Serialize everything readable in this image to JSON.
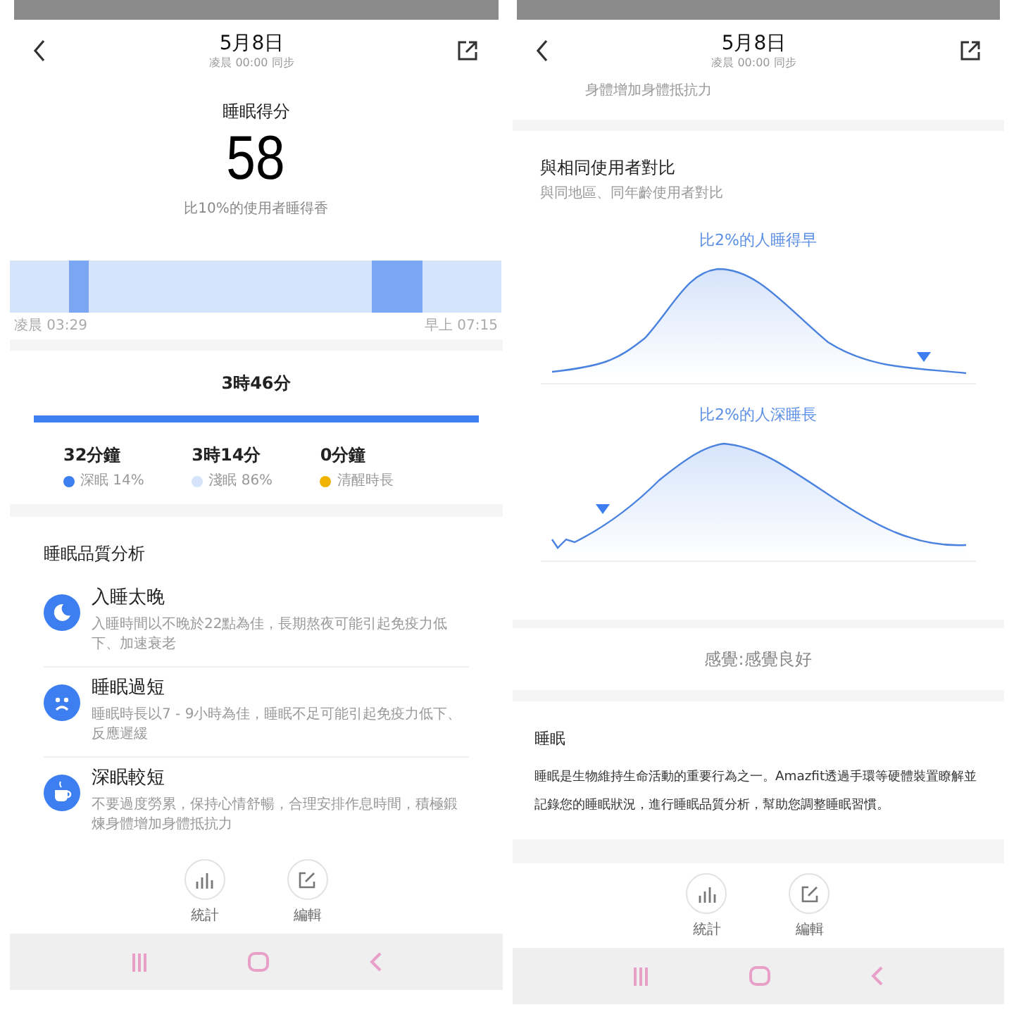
{
  "left_screen": {
    "header": {
      "title": "5月8日",
      "subtitle": "凌晨 00:00 同步"
    },
    "score": {
      "label": "睡眠得分",
      "value": "58",
      "comparison": "比10%的使用者睡得香"
    },
    "timeline": {
      "start": "凌晨 03:29",
      "end": "早上 07:15"
    },
    "duration": {
      "total": "3時46分",
      "level": 1,
      "stages": [
        {
          "value": "32分鐘",
          "label": "深眠 14%",
          "color": "#3d7ff0"
        },
        {
          "value": "3時14分",
          "label": "淺眠 86%",
          "color": "#d6e4fb"
        },
        {
          "value": "0分鐘",
          "label": "清醒時長",
          "color": "#f0b400"
        }
      ]
    },
    "analysis": {
      "title": "睡眠品質分析",
      "items": [
        {
          "kind": "moon",
          "title": "入睡太晚",
          "description": "入睡時間以不晚於22點為佳，長期熬夜可能引起免疫力低下、加速衰老"
        },
        {
          "kind": "sad",
          "title": "睡眠過短",
          "description": "睡眠時長以7 - 9小時為佳，睡眠不足可能引起免疫力低下、反應遲緩"
        },
        {
          "kind": "cup",
          "title": "深眠較短",
          "description": "不要過度勞累，保持心情舒暢，合理安排作息時間，積極鍛煉身體增加身體抵抗力"
        }
      ]
    },
    "toolbar": [
      {
        "kind": "stats",
        "label": "統計"
      },
      {
        "kind": "edit",
        "label": "編輯"
      }
    ]
  },
  "right_screen": {
    "header": {
      "title": "5月8日",
      "subtitle": "凌晨 00:00 同步"
    },
    "cut_text": "身體增加身體抵抗力",
    "comparison": {
      "title": "與相同使用者對比",
      "subtitle": "與同地區、同年齡使用者對比",
      "charts": [
        {
          "kind": "early",
          "caption": "比2%的人睡得早"
        },
        {
          "kind": "deep",
          "caption": "比2%的人深睡長"
        }
      ]
    },
    "feeling": "感覺:感覺良好",
    "about": {
      "title": "睡眠",
      "text": "睡眠是生物維持生命活動的重要行為之一。Amazfit透過手環等硬體裝置瞭解並記錄您的睡眠狀況，進行睡眠品質分析，幫助您調整睡眠習慣。"
    },
    "toolbar": [
      {
        "kind": "stats",
        "label": "統計"
      },
      {
        "kind": "edit",
        "label": "編輯"
      }
    ]
  }
}
